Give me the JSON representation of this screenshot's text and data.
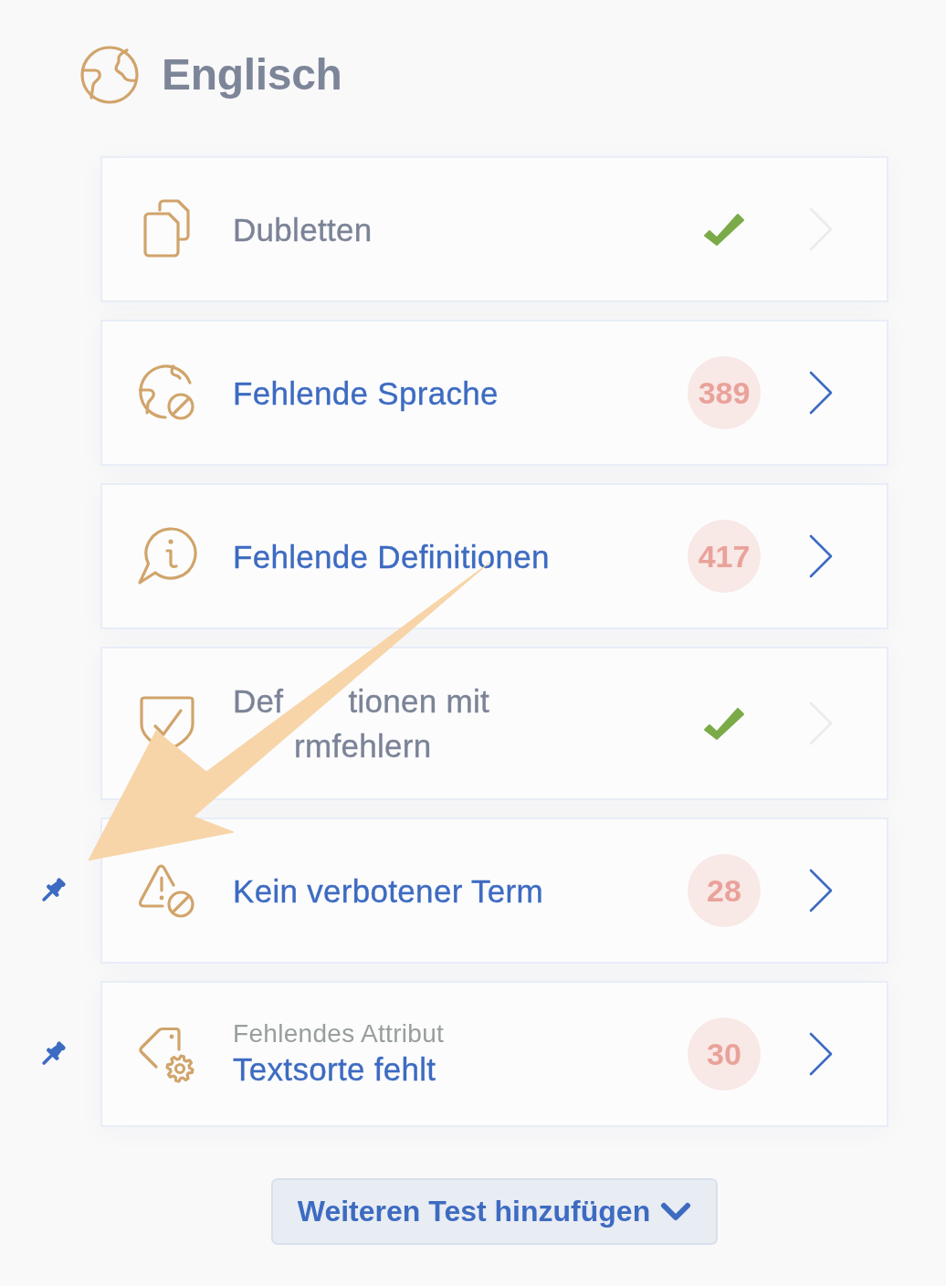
{
  "header": {
    "title": "Englisch"
  },
  "tests": [
    {
      "title": "Dubletten",
      "passed": true,
      "pinned": false
    },
    {
      "title": "Fehlende Sprache",
      "passed": false,
      "count": "389",
      "pinned": false
    },
    {
      "title": "Fehlende Definitionen",
      "passed": false,
      "count": "417",
      "pinned": false
    },
    {
      "title_lines": [
        [
          "Def",
          "tionen mit"
        ],
        [
          "rmfehlern"
        ]
      ],
      "passed": true,
      "pinned": false
    },
    {
      "title": "Kein verbotener Term",
      "passed": false,
      "count": "28",
      "pinned": true
    },
    {
      "category": "Fehlendes Attribut",
      "title": "Textsorte fehlt",
      "passed": false,
      "count": "30",
      "pinned": true
    }
  ],
  "add_test_button": {
    "label": "Weiteren Test hinzufügen"
  }
}
